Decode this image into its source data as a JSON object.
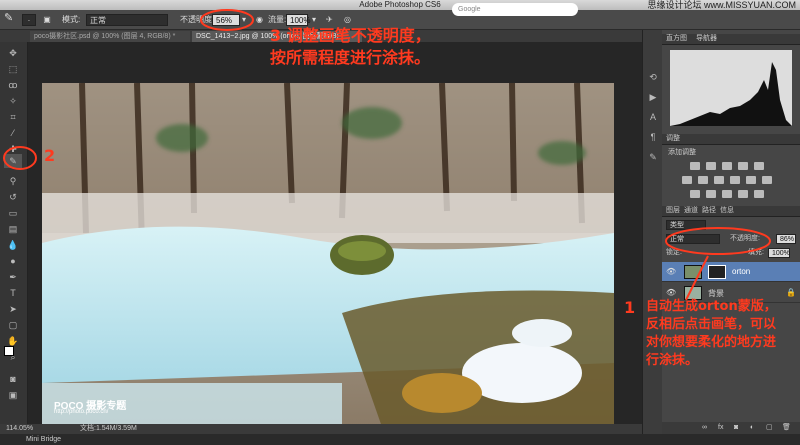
{
  "app": {
    "title": "Adobe Photoshop CS6",
    "watermark": "思缘设计论坛 www.MISSYUAN.COM"
  },
  "options": {
    "mode_label": "模式:",
    "mode_value": "正常",
    "opacity_label": "不透明度:",
    "opacity_value": "56%",
    "flow_label": "流量:",
    "flow_value": "100%",
    "search_placeholder": "Google"
  },
  "tabs": [
    {
      "label": "poco摄影社区.psd @ 100% (图层 4, RGB/8) *"
    },
    {
      "label": "DSC_1413~2.jpg @ 100% (orton, 图层蒙版/8) *"
    }
  ],
  "status": {
    "zoom": "114.05%",
    "doc": "文档:1.54M/3.59M"
  },
  "mini_bridge": "Mini Bridge",
  "photo_logo": {
    "brand": "POCO 摄影专题",
    "url": "http://photo.poco.cn/"
  },
  "panels": {
    "histogram": {
      "tab1": "直方图",
      "tab2": "导航器"
    },
    "adjust": {
      "tab": "调整",
      "add": "添加调整"
    },
    "layers": {
      "tab1": "图层",
      "tab2": "通道",
      "tab3": "路径",
      "tab4": "信息",
      "kind": "类型",
      "blend": "正常",
      "opacity_label": "不透明度:",
      "opacity_value": "86%",
      "lock_label": "锁定:",
      "fill_label": "填充:",
      "fill_value": "100%",
      "items": [
        {
          "name": "orton"
        },
        {
          "name": "背景"
        }
      ]
    }
  },
  "annotations": {
    "a1_num": "1",
    "a1_text": "自动生成orton蒙版，反相后点击画笔，可以对你想要柔化的地方进行涂抹。",
    "a2_num": "2",
    "a3_line1": "3 调整画笔不透明度，",
    "a3_line2": "按所需程度进行涂抹。"
  },
  "colors": {
    "accent": "#ff3a1f",
    "panel": "#464646",
    "selection": "#5a7fb5"
  }
}
